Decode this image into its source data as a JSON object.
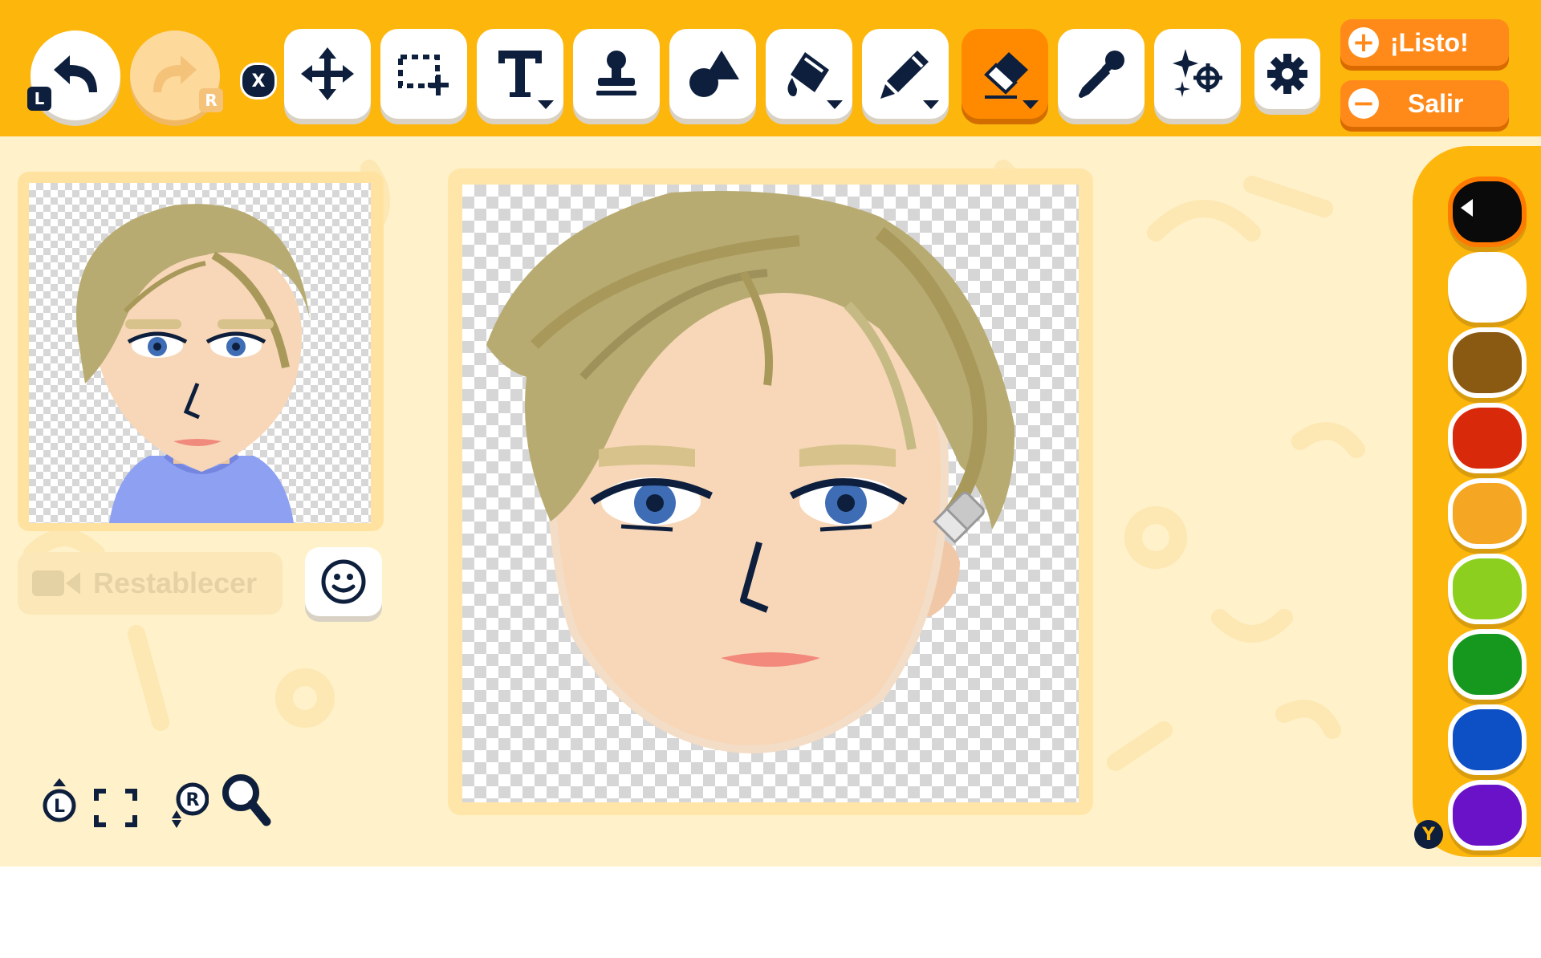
{
  "toolbar": {
    "undo": {
      "icon": "undo-icon",
      "button_badge": "L"
    },
    "redo": {
      "icon": "redo-icon",
      "button_badge": "R",
      "enabled": false
    },
    "cancel_badge": "X",
    "tools": [
      {
        "name": "move",
        "icon": "move-icon"
      },
      {
        "name": "select",
        "icon": "selection-icon"
      },
      {
        "name": "text",
        "icon": "text-icon",
        "has_menu": true
      },
      {
        "name": "stamp",
        "icon": "stamp-icon"
      },
      {
        "name": "shapes",
        "icon": "shapes-icon"
      },
      {
        "name": "fill",
        "icon": "paint-bucket-icon",
        "has_menu": true
      },
      {
        "name": "pen",
        "icon": "pen-icon",
        "has_menu": true
      },
      {
        "name": "eraser",
        "icon": "eraser-icon",
        "has_menu": true,
        "active": true
      },
      {
        "name": "eyedropper",
        "icon": "eyedropper-icon"
      },
      {
        "name": "effects",
        "icon": "sparkle-target-icon"
      }
    ],
    "settings_icon": "gear-icon",
    "done_symbol": "+",
    "done_label": "¡Listo!",
    "exit_symbol": "−",
    "exit_label": "Salir"
  },
  "preview": {
    "reset_label": "Restablecer",
    "reset_icon": "video-camera-icon",
    "face_icon": "smiley-face-icon"
  },
  "zoom": {
    "fit_badge": "L",
    "fit_icon": "fit-screen-icon",
    "zoom_badge": "R",
    "zoom_icon": "magnifier-icon"
  },
  "palette": {
    "button_badge": "Y",
    "colors": [
      "#0a0a0a",
      "#ffffff",
      "#8a5a12",
      "#d82a0a",
      "#f5a623",
      "#8ccf1e",
      "#16981e",
      "#0d4fc4",
      "#6a12c8"
    ],
    "selected_index": 0
  },
  "colors": {
    "toolbar_bg": "#fdb60c",
    "app_bg": "#fff1c9",
    "active_tool": "#ff8a00",
    "action_button": "#ff8a1a",
    "icon_navy": "#0d1f3c",
    "hair": "#b8ab72",
    "skin": "#f7d7b8"
  }
}
